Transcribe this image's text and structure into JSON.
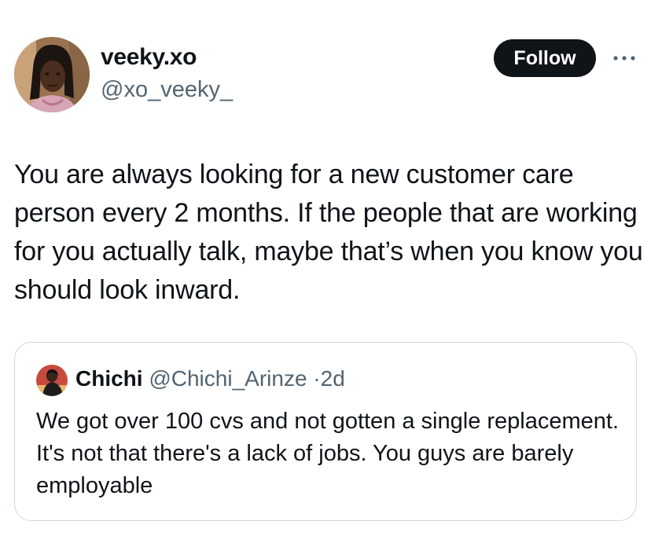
{
  "tweet": {
    "author": {
      "display_name": "veeky.xo",
      "handle": "@xo_veeky_"
    },
    "follow_label": "Follow",
    "text": "You are always looking for a new customer care person every 2 months. If the people that are working for you actually talk, maybe that’s when you know you should look inward."
  },
  "quoted_tweet": {
    "display_name": "Chichi",
    "handle": "@Chichi_Arinze",
    "separator": "·",
    "time": "2d",
    "text": "We got over 100 cvs and not gotten a single replacement. It's not that there's a lack of jobs. You guys are barely employable"
  },
  "colors": {
    "text_primary": "#0f1419",
    "text_secondary": "#536471",
    "border": "#cfd9de",
    "follow_bg": "#0f1419"
  },
  "icons": {
    "more": "more-options-icon"
  }
}
